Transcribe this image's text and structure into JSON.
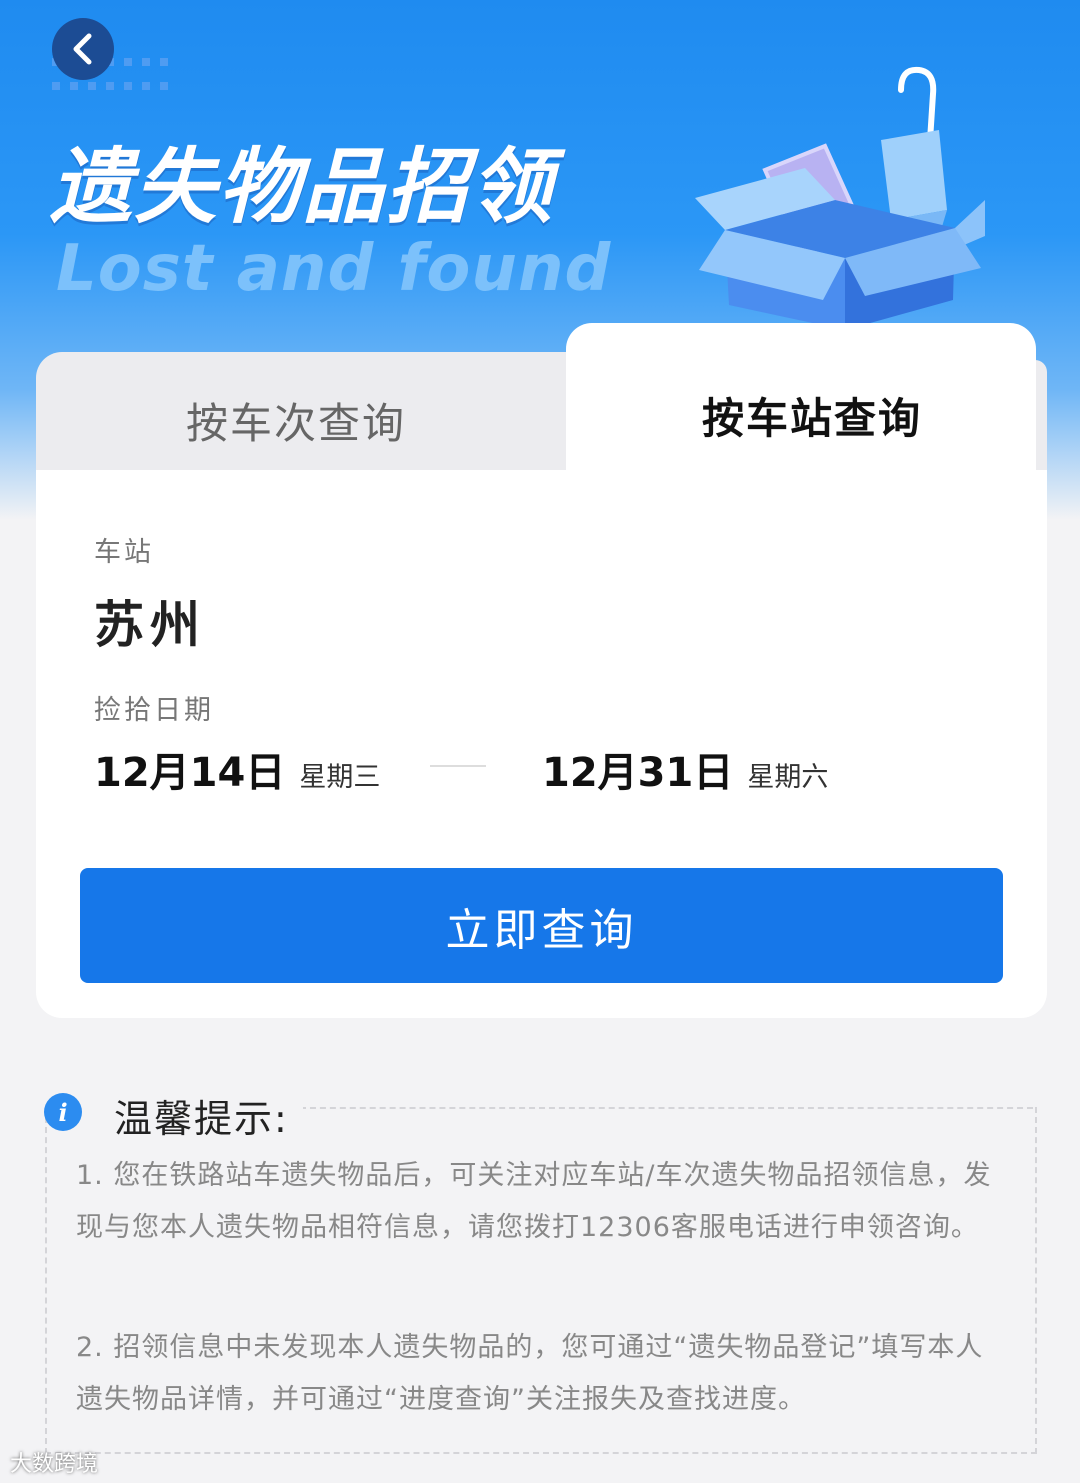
{
  "header": {
    "title_cn": "遗失物品招领",
    "title_en": "Lost and found"
  },
  "tabs": [
    {
      "label": "按车次查询",
      "active": false
    },
    {
      "label": "按车站查询",
      "active": true
    }
  ],
  "form": {
    "station_label": "车站",
    "station_value": "苏州",
    "date_label": "捡拾日期",
    "start_date": "12月14日",
    "start_weekday": "星期三",
    "end_date": "12月31日",
    "end_weekday": "星期六",
    "query_button": "立即查询"
  },
  "tips": {
    "title": "温馨提示:",
    "items": [
      "1. 您在铁路站车遗失物品后，可关注对应车站/车次遗失物品招领信息，发现与您本人遗失物品相符信息，请您拨打12306客服电话进行申领咨询。",
      "2. 招领信息中未发现本人遗失物品的，您可通过“遗失物品登记”填写本人遗失物品详情，并可通过“进度查询”关注报失及查找进度。"
    ]
  },
  "watermark": "大数跨境",
  "colors": {
    "primary": "#1677e9",
    "hero_blue": "#1f8bf0",
    "background": "#f3f3f5"
  },
  "icons": {
    "back": "chevron-left-icon",
    "info": "info-icon",
    "illustration": "box-umbrella-illustration"
  }
}
